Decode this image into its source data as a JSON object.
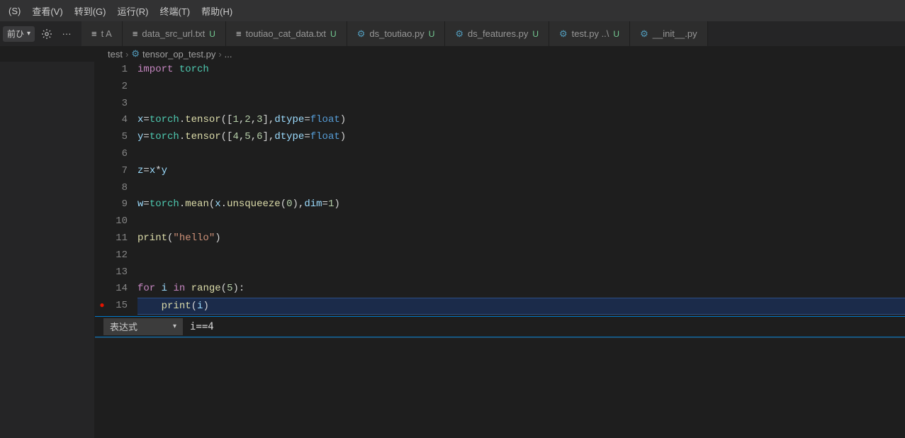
{
  "menubar": [
    {
      "label": "(S)"
    },
    {
      "label": "查看(V)"
    },
    {
      "label": "转到(G)"
    },
    {
      "label": "运行(R)"
    },
    {
      "label": "终端(T)"
    },
    {
      "label": "帮助(H)"
    }
  ],
  "debug": {
    "selector": "前ひ",
    "gear": "⚙",
    "more": "···"
  },
  "tabs": [
    {
      "icon": "txt",
      "label": "t A",
      "status": "",
      "cls": ""
    },
    {
      "icon": "txt",
      "label": "data_src_url.txt",
      "status": "U",
      "cls": "u"
    },
    {
      "icon": "txt",
      "label": "toutiao_cat_data.txt",
      "status": "U",
      "cls": "u"
    },
    {
      "icon": "py",
      "label": "ds_toutiao.py",
      "status": "U",
      "cls": "u"
    },
    {
      "icon": "py",
      "label": "ds_features.py",
      "status": "U",
      "cls": "u"
    },
    {
      "icon": "py",
      "label": "test.py ..\\",
      "status": "U",
      "cls": "u"
    },
    {
      "icon": "py",
      "label": "__init__.py",
      "status": "",
      "cls": ""
    }
  ],
  "breadcrumbs": {
    "part1": "test",
    "part2": "tensor_op_test.py",
    "part3": "..."
  },
  "code": {
    "lines": [
      {
        "n": 1,
        "bp": false,
        "tokens": [
          [
            "kw",
            "import"
          ],
          [
            "pun",
            " "
          ],
          [
            "mod",
            "torch"
          ]
        ]
      },
      {
        "n": 2,
        "bp": false,
        "tokens": []
      },
      {
        "n": 3,
        "bp": false,
        "tokens": []
      },
      {
        "n": 4,
        "bp": false,
        "tokens": [
          [
            "var",
            "x"
          ],
          [
            "op",
            "="
          ],
          [
            "mod",
            "torch"
          ],
          [
            "pun",
            "."
          ],
          [
            "fn",
            "tensor"
          ],
          [
            "pun",
            "(["
          ],
          [
            "num",
            "1"
          ],
          [
            "pun",
            ","
          ],
          [
            "num",
            "2"
          ],
          [
            "pun",
            ","
          ],
          [
            "num",
            "3"
          ],
          [
            "pun",
            "],"
          ],
          [
            "param",
            "dtype"
          ],
          [
            "op",
            "="
          ],
          [
            "builtin",
            "float"
          ],
          [
            "pun",
            ")"
          ]
        ]
      },
      {
        "n": 5,
        "bp": false,
        "tokens": [
          [
            "var",
            "y"
          ],
          [
            "op",
            "="
          ],
          [
            "mod",
            "torch"
          ],
          [
            "pun",
            "."
          ],
          [
            "fn",
            "tensor"
          ],
          [
            "pun",
            "(["
          ],
          [
            "num",
            "4"
          ],
          [
            "pun",
            ","
          ],
          [
            "num",
            "5"
          ],
          [
            "pun",
            ","
          ],
          [
            "num",
            "6"
          ],
          [
            "pun",
            "],"
          ],
          [
            "param",
            "dtype"
          ],
          [
            "op",
            "="
          ],
          [
            "builtin",
            "float"
          ],
          [
            "pun",
            ")"
          ]
        ]
      },
      {
        "n": 6,
        "bp": false,
        "tokens": []
      },
      {
        "n": 7,
        "bp": false,
        "tokens": [
          [
            "var",
            "z"
          ],
          [
            "op",
            "="
          ],
          [
            "var",
            "x"
          ],
          [
            "op",
            "*"
          ],
          [
            "var",
            "y"
          ]
        ]
      },
      {
        "n": 8,
        "bp": false,
        "tokens": []
      },
      {
        "n": 9,
        "bp": false,
        "tokens": [
          [
            "var",
            "w"
          ],
          [
            "op",
            "="
          ],
          [
            "mod",
            "torch"
          ],
          [
            "pun",
            "."
          ],
          [
            "fn",
            "mean"
          ],
          [
            "pun",
            "("
          ],
          [
            "var",
            "x"
          ],
          [
            "pun",
            "."
          ],
          [
            "fn",
            "unsqueeze"
          ],
          [
            "pun",
            "("
          ],
          [
            "num",
            "0"
          ],
          [
            "pun",
            "),"
          ],
          [
            "param",
            "dim"
          ],
          [
            "op",
            "="
          ],
          [
            "num",
            "1"
          ],
          [
            "pun",
            ")"
          ]
        ]
      },
      {
        "n": 10,
        "bp": false,
        "tokens": []
      },
      {
        "n": 11,
        "bp": false,
        "tokens": [
          [
            "fn",
            "print"
          ],
          [
            "pun",
            "("
          ],
          [
            "str",
            "\"hello\""
          ],
          [
            "pun",
            ")"
          ]
        ]
      },
      {
        "n": 12,
        "bp": false,
        "tokens": []
      },
      {
        "n": 13,
        "bp": false,
        "tokens": []
      },
      {
        "n": 14,
        "bp": false,
        "tokens": [
          [
            "kw",
            "for"
          ],
          [
            "pun",
            " "
          ],
          [
            "var",
            "i"
          ],
          [
            "pun",
            " "
          ],
          [
            "kw",
            "in"
          ],
          [
            "pun",
            " "
          ],
          [
            "fn",
            "range"
          ],
          [
            "pun",
            "("
          ],
          [
            "num",
            "5"
          ],
          [
            "pun",
            "):"
          ]
        ]
      },
      {
        "n": 15,
        "bp": true,
        "current": true,
        "tokens": [
          [
            "pun",
            "    "
          ],
          [
            "fn",
            "print"
          ],
          [
            "pun",
            "("
          ],
          [
            "var",
            "i"
          ],
          [
            "pun",
            ")"
          ]
        ]
      }
    ]
  },
  "cond_bp": {
    "type_label": "表达式",
    "value": "i==4"
  }
}
